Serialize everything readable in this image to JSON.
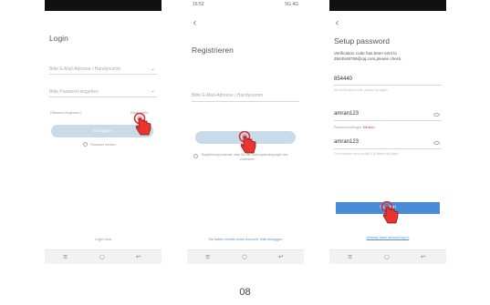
{
  "screens": {
    "login": {
      "title": "Login",
      "email_placeholder": "Bitte E-Mail-Adresse / Handynumm",
      "password_placeholder": "Bitte Passwort eingeben",
      "forgot": "Passwort vergessen?",
      "register_link": "Registrieren",
      "button": "Einloggen",
      "remember": "Passwort merken",
      "bottom_link": "Login Iokal"
    },
    "register": {
      "status_time": "16:52",
      "status_right": "5G 4G",
      "title": "Registrieren",
      "email_placeholder": "Bitte E-Mail-Adresse / Handynumm",
      "button": "Weiter",
      "agree_line1": "Registrierung bedeutet, dass Sie den Nutzungsbedingungen des",
      "agree_line2": "zustimmen",
      "bottom_link": "Sie haben bereits einen Account, bitte einloggen"
    },
    "setup": {
      "title": "Setup password",
      "info_line1": "Verification code has been sent to",
      "info_line2": "2844548789@qq.com,please check.",
      "code": "854440",
      "code_hint": "No verification code, please try again",
      "password": "amran123",
      "strength_label": "Password strength:",
      "strength_value": "Medium",
      "confirm_password": "amran123",
      "password_rule": "The password must contain 6-20 letters and digits",
      "button": "Confirm",
      "bottom_link": "Already have account,log in"
    }
  },
  "nav": {
    "menu": "≡",
    "home": "○",
    "back": "↩"
  },
  "colors": {
    "accent": "#4a8bd8",
    "strength": "#d9303b",
    "pill": "#c9dbe8"
  },
  "page_number": "08"
}
